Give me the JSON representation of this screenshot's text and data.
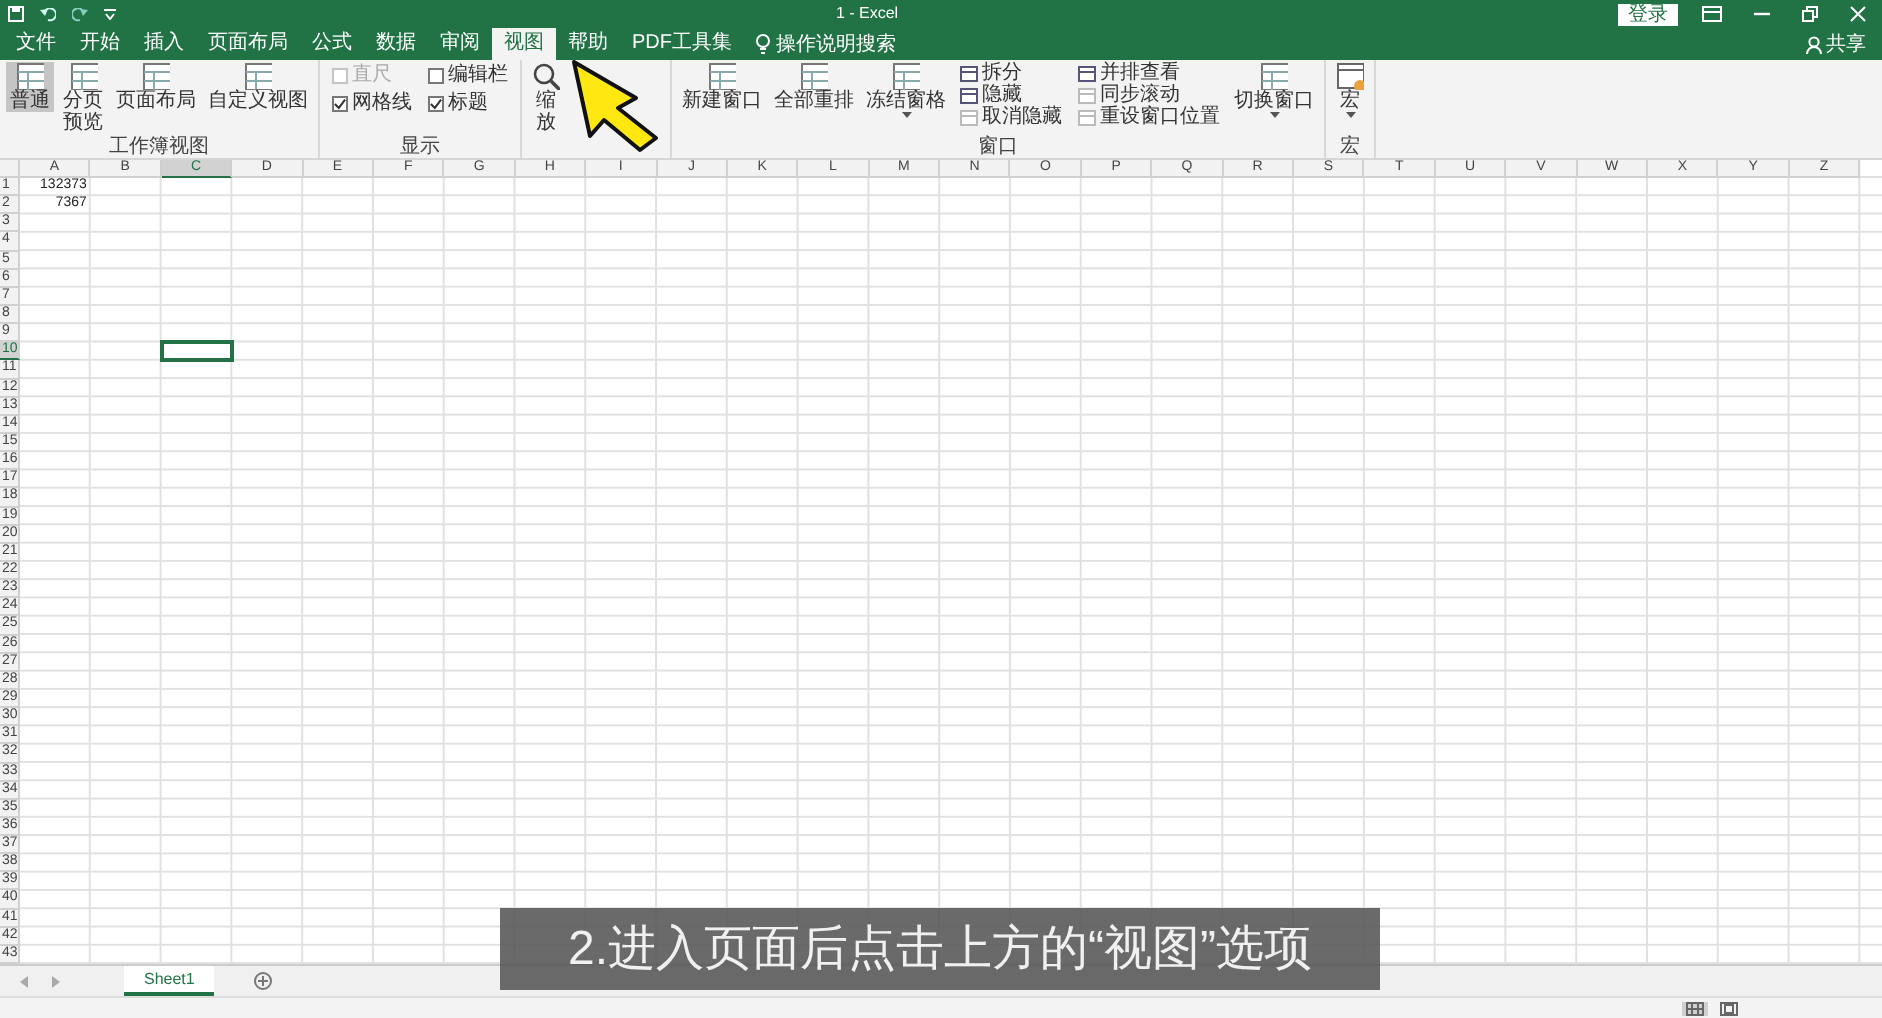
{
  "window": {
    "title": "1 - Excel",
    "sign_in": "登录",
    "share": "共享"
  },
  "menu_tabs": [
    {
      "label": "文件",
      "selected": false
    },
    {
      "label": "开始",
      "selected": false
    },
    {
      "label": "插入",
      "selected": false
    },
    {
      "label": "页面布局",
      "selected": false
    },
    {
      "label": "公式",
      "selected": false
    },
    {
      "label": "数据",
      "selected": false
    },
    {
      "label": "审阅",
      "selected": false
    },
    {
      "label": "视图",
      "selected": true
    },
    {
      "label": "帮助",
      "selected": false
    },
    {
      "label": "PDF工具集",
      "selected": false
    }
  ],
  "tell_me": {
    "label": "操作说明搜索"
  },
  "ribbon_groups": [
    {
      "label": "工作簿视图",
      "columns": [
        [
          {
            "kind": "large",
            "label": "普通",
            "selected": true,
            "dropdown": false
          }
        ],
        [
          {
            "kind": "large-stacked",
            "label": "分页预览",
            "selected": false,
            "dropdown": false
          }
        ],
        [
          {
            "kind": "large",
            "label": "页面布局",
            "selected": false,
            "dropdown": false
          }
        ],
        [
          {
            "kind": "large",
            "label": "自定义视图",
            "selected": false,
            "dropdown": false
          }
        ]
      ]
    },
    {
      "label": "显示",
      "columns": [
        [
          {
            "kind": "check",
            "label": "直尺",
            "checked": false,
            "disabled": true
          },
          {
            "kind": "check",
            "label": "网格线",
            "checked": true,
            "disabled": false
          }
        ],
        [
          {
            "kind": "check",
            "label": "编辑栏",
            "checked": false,
            "disabled": false
          },
          {
            "kind": "check",
            "label": "标题",
            "checked": true,
            "disabled": false
          }
        ]
      ]
    },
    {
      "columns": [
        [
          {
            "kind": "zoom",
            "label": "缩放",
            "dropdown": false
          }
        ]
      ]
    },
    {
      "label": "窗口",
      "columns": [
        [
          {
            "kind": "large",
            "label": "新建窗口",
            "dropdown": false
          }
        ],
        [
          {
            "kind": "large",
            "label": "全部重排",
            "dropdown": false
          }
        ],
        [
          {
            "kind": "large",
            "label": "冻结窗格",
            "dropdown": true
          }
        ],
        [
          {
            "kind": "small",
            "label": "拆分",
            "disabled": false
          },
          {
            "kind": "small",
            "label": "隐藏",
            "disabled": false
          },
          {
            "kind": "small",
            "label": "取消隐藏",
            "disabled": true
          }
        ],
        [
          {
            "kind": "small",
            "label": "并排查看",
            "disabled": false
          },
          {
            "kind": "small",
            "label": "同步滚动",
            "disabled": true
          },
          {
            "kind": "small",
            "label": "重设窗口位置",
            "disabled": true
          }
        ],
        [
          {
            "kind": "large",
            "label": "切换窗口",
            "dropdown": true
          }
        ]
      ]
    },
    {
      "label": "宏",
      "columns": [
        [
          {
            "kind": "macro",
            "label": "宏",
            "dropdown": true
          }
        ]
      ]
    }
  ],
  "sheet": {
    "columns": [
      {
        "label": "A",
        "selected": false
      },
      {
        "label": "B",
        "selected": false
      },
      {
        "label": "C",
        "selected": true
      },
      {
        "label": "D",
        "selected": false
      },
      {
        "label": "E",
        "selected": false
      },
      {
        "label": "F",
        "selected": false
      },
      {
        "label": "G",
        "selected": false
      },
      {
        "label": "H",
        "selected": false
      },
      {
        "label": "I",
        "selected": false
      },
      {
        "label": "J",
        "selected": false
      },
      {
        "label": "K",
        "selected": false
      },
      {
        "label": "L",
        "selected": false
      },
      {
        "label": "M",
        "selected": false
      },
      {
        "label": "N",
        "selected": false
      },
      {
        "label": "O",
        "selected": false
      },
      {
        "label": "P",
        "selected": false
      },
      {
        "label": "Q",
        "selected": false
      },
      {
        "label": "R",
        "selected": false
      },
      {
        "label": "S",
        "selected": false
      },
      {
        "label": "T",
        "selected": false
      },
      {
        "label": "U",
        "selected": false
      },
      {
        "label": "V",
        "selected": false
      },
      {
        "label": "W",
        "selected": false
      },
      {
        "label": "X",
        "selected": false
      },
      {
        "label": "Y",
        "selected": false
      },
      {
        "label": "Z",
        "selected": false
      }
    ],
    "rows": [
      {
        "header": "1",
        "selected": false,
        "cells": [
          "132373"
        ]
      },
      {
        "header": "2",
        "selected": false,
        "cells": [
          "7367"
        ]
      },
      {
        "header": "3",
        "selected": false
      },
      {
        "header": "4",
        "selected": false
      },
      {
        "header": "5",
        "selected": false
      },
      {
        "header": "6",
        "selected": false
      },
      {
        "header": "7",
        "selected": false
      },
      {
        "header": "8",
        "selected": false
      },
      {
        "header": "9",
        "selected": false
      },
      {
        "header": "10",
        "selected": true
      },
      {
        "header": "11",
        "selected": false
      },
      {
        "header": "12",
        "selected": false
      },
      {
        "header": "13",
        "selected": false
      },
      {
        "header": "14",
        "selected": false
      },
      {
        "header": "15",
        "selected": false
      },
      {
        "header": "16",
        "selected": false
      },
      {
        "header": "17",
        "selected": false
      },
      {
        "header": "18",
        "selected": false
      },
      {
        "header": "19",
        "selected": false
      },
      {
        "header": "20",
        "selected": false
      },
      {
        "header": "21",
        "selected": false
      },
      {
        "header": "22",
        "selected": false
      },
      {
        "header": "23",
        "selected": false
      },
      {
        "header": "24",
        "selected": false
      },
      {
        "header": "25",
        "selected": false
      },
      {
        "header": "26",
        "selected": false
      },
      {
        "header": "27",
        "selected": false
      },
      {
        "header": "28",
        "selected": false
      },
      {
        "header": "29",
        "selected": false
      },
      {
        "header": "30",
        "selected": false
      },
      {
        "header": "31",
        "selected": false
      },
      {
        "header": "32",
        "selected": false
      },
      {
        "header": "33",
        "selected": false
      },
      {
        "header": "34",
        "selected": false
      },
      {
        "header": "35",
        "selected": false
      },
      {
        "header": "36",
        "selected": false
      },
      {
        "header": "37",
        "selected": false
      },
      {
        "header": "38",
        "selected": false
      },
      {
        "header": "39",
        "selected": false
      },
      {
        "header": "40",
        "selected": false
      },
      {
        "header": "41",
        "selected": false
      },
      {
        "header": "42",
        "selected": false
      },
      {
        "header": "43",
        "selected": false
      }
    ]
  },
  "sheet_tabs": [
    {
      "label": "Sheet1",
      "selected": true
    }
  ],
  "view_buttons": [
    {
      "selected": true
    },
    {
      "selected": false
    }
  ],
  "subtitle": "2.进入页面后点击上方的“视图”选项"
}
